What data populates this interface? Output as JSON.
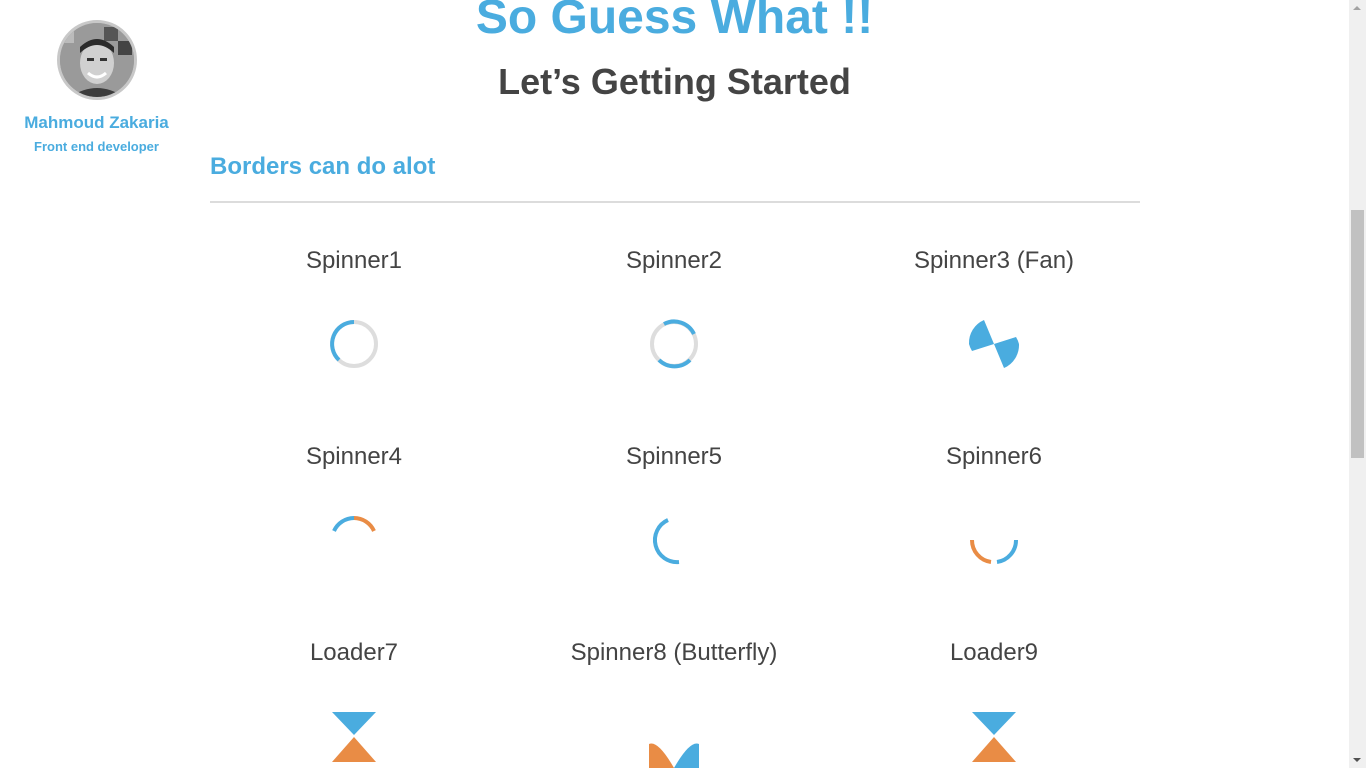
{
  "profile": {
    "name": "Mahmoud Zakaria",
    "role": "Front end developer"
  },
  "hero": {
    "title": "So Guess What !!",
    "subtitle": "Let’s Getting Started"
  },
  "section": {
    "title": "Borders can do alot"
  },
  "demos": [
    {
      "label": "Spinner1"
    },
    {
      "label": "Spinner2"
    },
    {
      "label": "Spinner3 (Fan)"
    },
    {
      "label": "Spinner4"
    },
    {
      "label": "Spinner5"
    },
    {
      "label": "Spinner6"
    },
    {
      "label": "Loader7"
    },
    {
      "label": "Spinner8 (Butterfly)"
    },
    {
      "label": "Loader9"
    }
  ],
  "colors": {
    "accent_blue": "#4aacdf",
    "accent_orange": "#e98c45",
    "ring_gray": "#dddddd",
    "heading_text": "#444444"
  },
  "icons": {
    "scroll_up": "triangle-up",
    "scroll_down": "triangle-down"
  }
}
